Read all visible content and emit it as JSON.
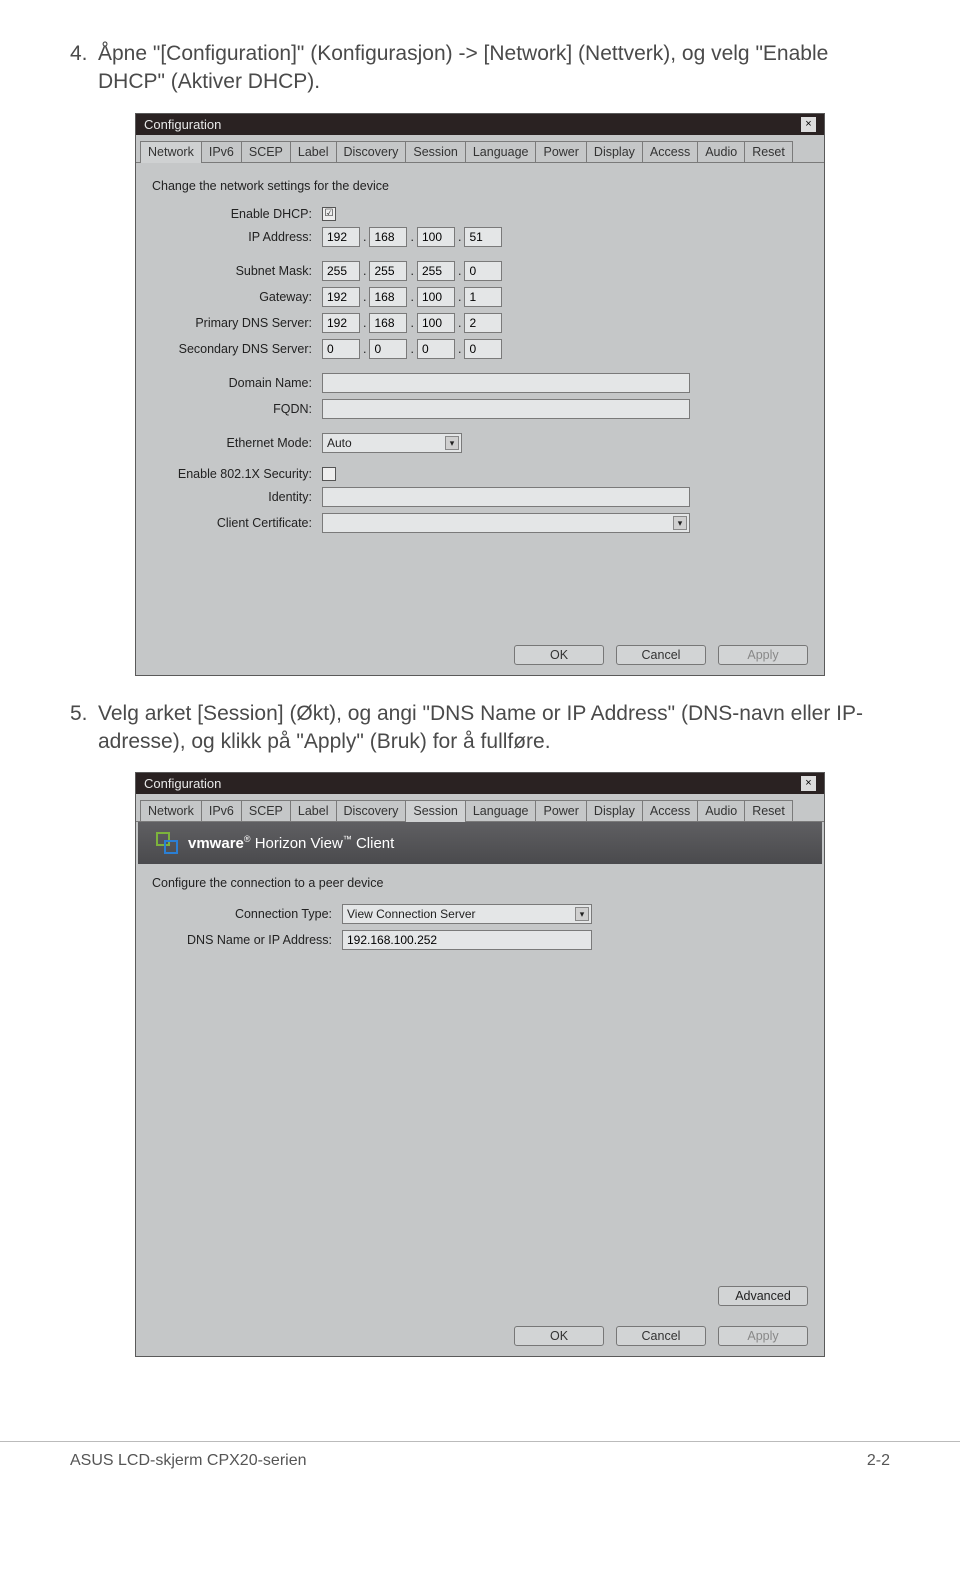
{
  "step4": {
    "num": "4.",
    "text": "Åpne \"[Configuration]\" (Konfigurasjon) -> [Network] (Nettverk), og velg \"Enable DHCP\" (Aktiver DHCP)."
  },
  "step5": {
    "num": "5.",
    "text": "Velg arket [Session] (Økt), og angi \"DNS Name or IP Address\" (DNS-navn eller IP-adresse), og klikk på \"Apply\" (Bruk) for å fullføre."
  },
  "dialog1": {
    "title": "Configuration",
    "tabs": [
      "Network",
      "IPv6",
      "SCEP",
      "Label",
      "Discovery",
      "Session",
      "Language",
      "Power",
      "Display",
      "Access",
      "Audio",
      "Reset"
    ],
    "active_tab": "Network",
    "desc": "Change the network settings for the device",
    "labels": {
      "enable_dhcp": "Enable DHCP:",
      "ip_address": "IP Address:",
      "subnet_mask": "Subnet Mask:",
      "gateway": "Gateway:",
      "primary_dns": "Primary DNS Server:",
      "secondary_dns": "Secondary DNS Server:",
      "domain_name": "Domain Name:",
      "fqdn": "FQDN:",
      "ethernet_mode": "Ethernet Mode:",
      "enable_8021x": "Enable 802.1X Security:",
      "identity": "Identity:",
      "client_cert": "Client Certificate:"
    },
    "values": {
      "enable_dhcp_checked": "☑",
      "ip": [
        "192",
        "168",
        "100",
        "51"
      ],
      "subnet": [
        "255",
        "255",
        "255",
        "0"
      ],
      "gateway": [
        "192",
        "168",
        "100",
        "1"
      ],
      "pdns": [
        "192",
        "168",
        "100",
        "2"
      ],
      "sdns": [
        "0",
        "0",
        "0",
        "0"
      ],
      "domain_name": "",
      "fqdn": "",
      "ethernet_mode": "Auto",
      "enable_8021x_checked": "",
      "identity": "",
      "client_cert": ""
    },
    "buttons": {
      "ok": "OK",
      "cancel": "Cancel",
      "apply": "Apply"
    }
  },
  "dialog2": {
    "title": "Configuration",
    "tabs": [
      "Network",
      "IPv6",
      "SCEP",
      "Label",
      "Discovery",
      "Session",
      "Language",
      "Power",
      "Display",
      "Access",
      "Audio",
      "Reset"
    ],
    "active_tab": "Session",
    "banner_brand": "vmware",
    "banner_product": "Horizon View",
    "banner_suffix": "Client",
    "desc": "Configure the connection to a peer device",
    "labels": {
      "connection_type": "Connection Type:",
      "dns_or_ip": "DNS Name or IP Address:"
    },
    "values": {
      "connection_type": "View Connection Server",
      "dns_or_ip": "192.168.100.252"
    },
    "buttons": {
      "advanced": "Advanced",
      "ok": "OK",
      "cancel": "Cancel",
      "apply": "Apply"
    }
  },
  "footer": {
    "left": "ASUS LCD-skjerm CPX20-serien",
    "right": "2-2"
  }
}
